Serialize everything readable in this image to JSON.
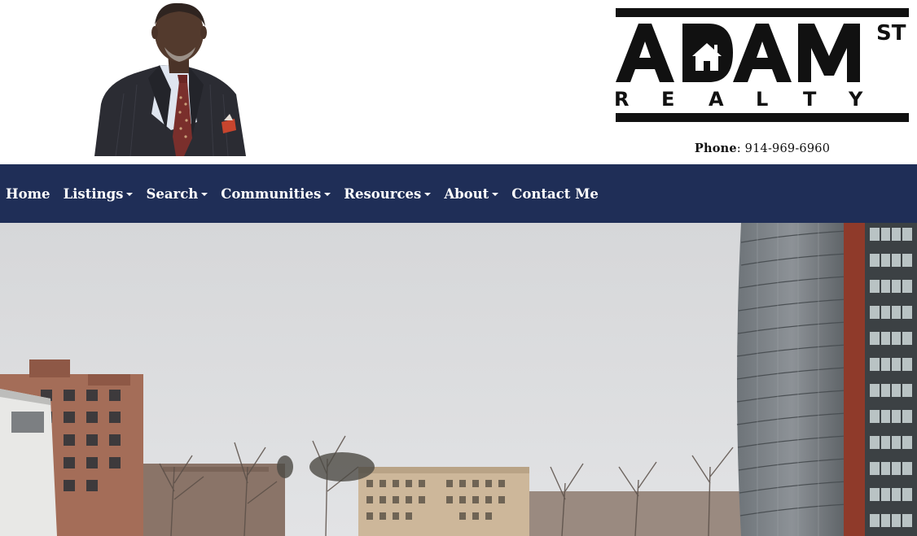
{
  "header": {
    "agent_photo_alt": "agent-portrait",
    "logo": {
      "line1": "ADAM",
      "superscript": "ST",
      "line2": "REALTY"
    },
    "phone": {
      "label": "Phone",
      "separator": ":",
      "number": "914-969-6960"
    }
  },
  "nav": {
    "items": [
      {
        "label": "Home",
        "dropdown": false
      },
      {
        "label": "Listings",
        "dropdown": true
      },
      {
        "label": "Search",
        "dropdown": true
      },
      {
        "label": "Communities",
        "dropdown": true
      },
      {
        "label": "Resources",
        "dropdown": true
      },
      {
        "label": "About",
        "dropdown": true
      },
      {
        "label": "Contact Me",
        "dropdown": false
      }
    ]
  },
  "colors": {
    "nav_bg": "#1f2e57",
    "nav_text": "#ffffff",
    "logo": "#111111"
  }
}
